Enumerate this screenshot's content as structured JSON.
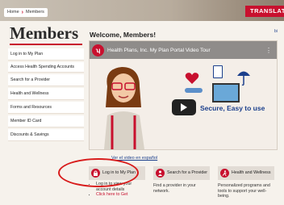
{
  "breadcrumb": {
    "home": "Home",
    "current": "Members"
  },
  "translate_label": "TRANSLATE",
  "top_right_link": "bi",
  "sidebar": {
    "title": "Members",
    "items": [
      {
        "label": "Log in to My Plan"
      },
      {
        "label": "Access Health Spending Accounts"
      },
      {
        "label": "Search for a Provider"
      },
      {
        "label": "Health and Wellness"
      },
      {
        "label": "Forms and Resources"
      },
      {
        "label": "Member ID Card"
      },
      {
        "label": "Discounts & Savings"
      }
    ]
  },
  "main": {
    "welcome": "Welcome, Members!",
    "video": {
      "title": "Health Plans, Inc. My Plan Portal Video Tour",
      "caption": "Secure, Easy to use",
      "spanish_link": "Ver el video en español"
    },
    "cards": [
      {
        "button": "Log in to My Plan",
        "bullets": [
          "Log in to view your account details",
          "Click here to Get"
        ]
      },
      {
        "button": "Search for a Provider",
        "body": "Find a provider in your network."
      },
      {
        "button": "Health and Wellness",
        "body": "Personalized programs and tools to support your well-being."
      }
    ]
  },
  "colors": {
    "brand_red": "#c8102e",
    "link_blue": "#1b3f8c",
    "highlight_oval": "#d81b1b"
  }
}
